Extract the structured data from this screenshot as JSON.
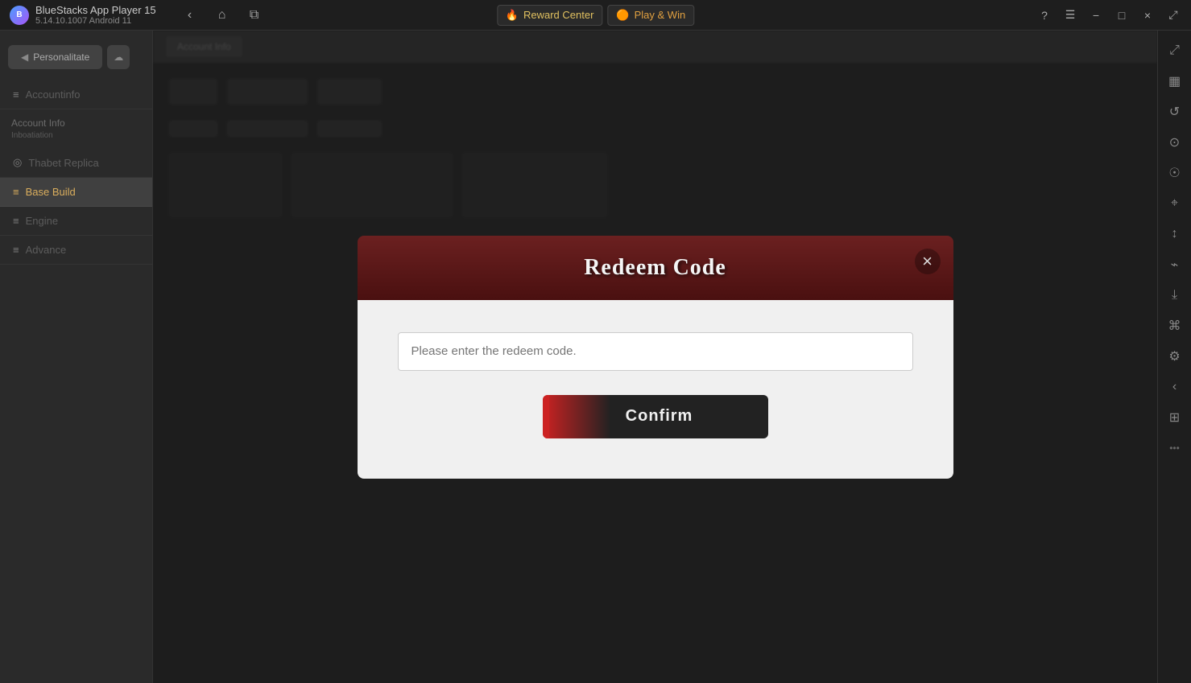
{
  "titleBar": {
    "appName": "BlueStacks App Player 15",
    "appVersion": "5.14.10.1007  Android 11",
    "rewardCenter": "Reward Center",
    "playAndWin": "Play & Win"
  },
  "windowControls": {
    "minimize": "−",
    "maximize": "□",
    "close": "×",
    "restore": "⤢"
  },
  "navButtons": {
    "back": "‹",
    "home": "⌂",
    "tabs": "⧉"
  },
  "modal": {
    "title": "Redeem Code",
    "closeIcon": "×",
    "inputPlaceholder": "Please enter the redeem code.",
    "confirmLabel": "Confirm"
  },
  "sidebar": {
    "items": [
      {
        "label": "Personalitate",
        "icon": "◀"
      },
      {
        "label": "cloud",
        "icon": "☁"
      },
      {
        "label": "Accountinfo",
        "icon": "≡"
      },
      {
        "label": "Thabet Replica",
        "icon": "◎"
      },
      {
        "label": "Base Build",
        "icon": "≡"
      },
      {
        "label": "Engine",
        "icon": "≡"
      },
      {
        "label": "Advance",
        "icon": "≡"
      }
    ]
  },
  "rightSidebar": {
    "buttons": [
      "◉",
      "▦",
      "↺",
      "⊙",
      "☰",
      "⌖",
      "↕",
      "⌁",
      "⤓",
      "⚙",
      "‹",
      "⊞",
      "…"
    ]
  },
  "colors": {
    "accent": "#cc2222",
    "titleBg": "#1e1e1e",
    "modalHeaderTop": "#6b2020",
    "modalHeaderBot": "#4a1010",
    "modalBodyBg": "#f0f0f0"
  }
}
